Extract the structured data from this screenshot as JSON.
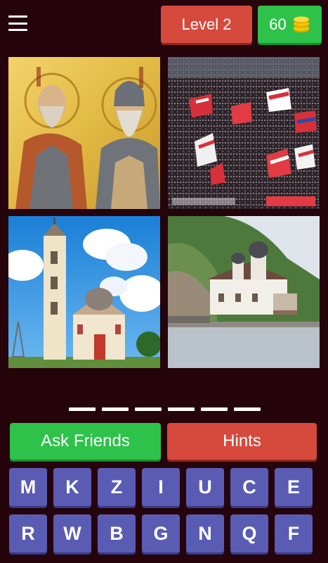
{
  "header": {
    "menu_icon": "hamburger-menu-icon",
    "level_label": "Level 2",
    "coins": "60",
    "coin_icon": "coin-stack-icon"
  },
  "images": [
    {
      "name": "image-saints-icon",
      "subject": "saints-icon-painting"
    },
    {
      "name": "image-stadium-crowd",
      "subject": "crowd-with-red-white-flags"
    },
    {
      "name": "image-church-belltower",
      "subject": "church-with-bell-tower"
    },
    {
      "name": "image-riverside-monastery",
      "subject": "monastery-by-river"
    }
  ],
  "answer": {
    "slots": 6
  },
  "buttons": {
    "ask_friends": "Ask Friends",
    "hints": "Hints"
  },
  "keyboard": {
    "keys": [
      "M",
      "K",
      "Z",
      "I",
      "U",
      "C",
      "E",
      "R",
      "W",
      "B",
      "G",
      "N",
      "Q",
      "F"
    ]
  },
  "colors": {
    "background": "#25040c",
    "accent_red": "#d64a3d",
    "accent_green": "#2ec24a",
    "key_blue": "#5a5cb4"
  }
}
